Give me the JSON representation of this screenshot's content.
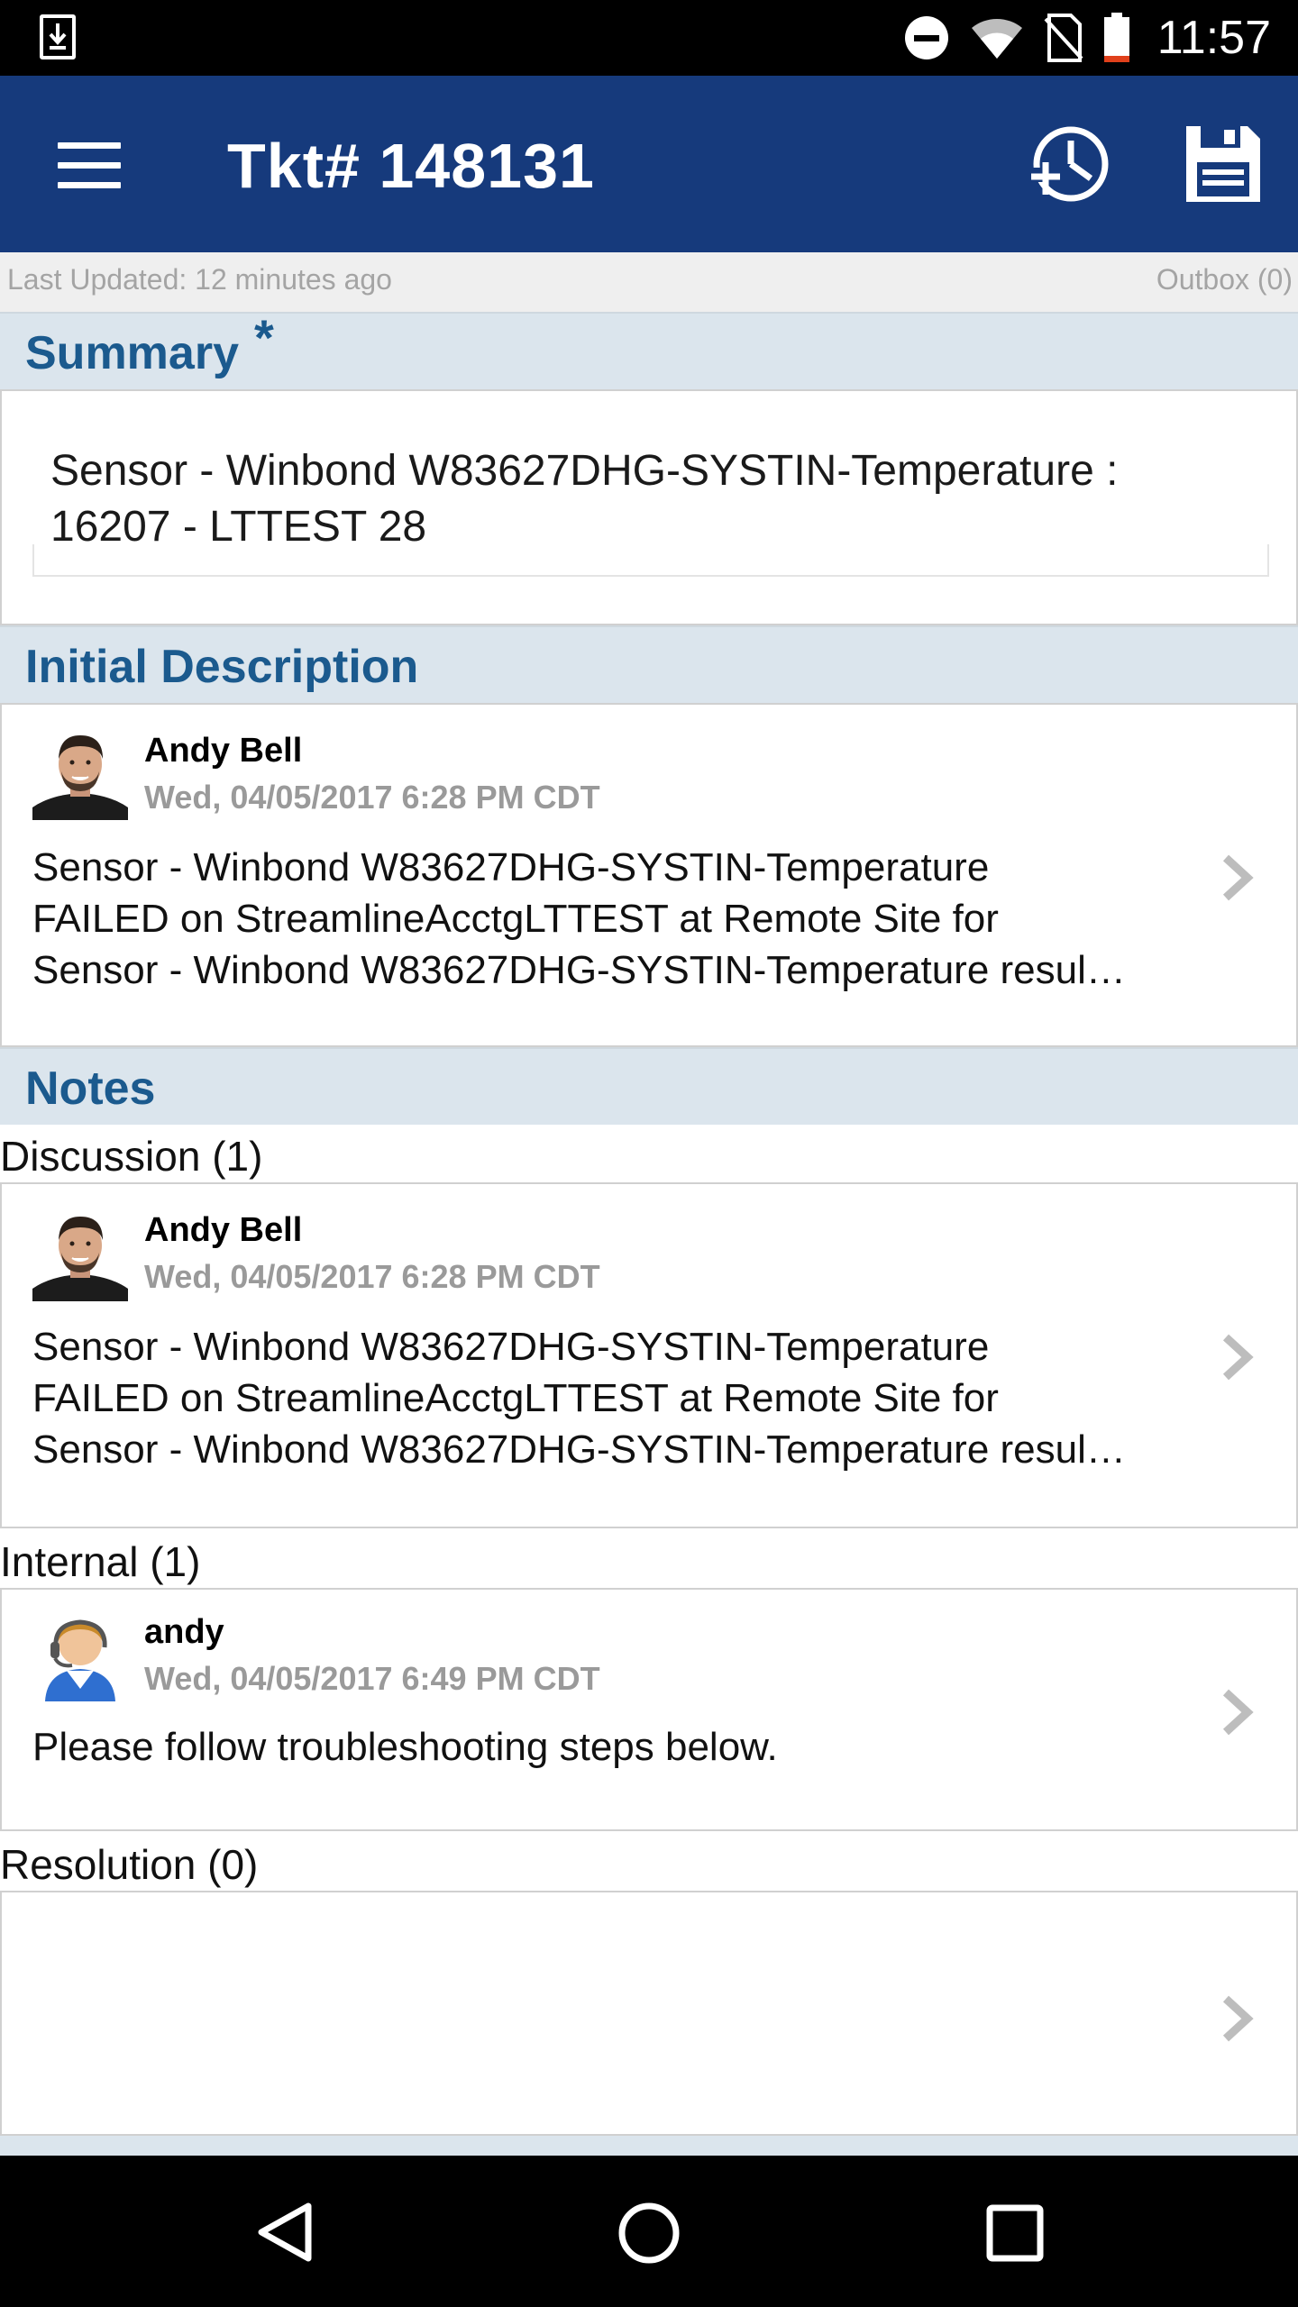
{
  "status_bar": {
    "time": "11:57",
    "icons": [
      "download-icon",
      "dnd-icon",
      "wifi-icon",
      "no-sim-icon",
      "battery-icon"
    ]
  },
  "app_bar": {
    "title": "Tkt# 148131",
    "icons": [
      "menu-icon",
      "time-entry-icon",
      "save-icon"
    ],
    "color": "#163a7c"
  },
  "info": {
    "last_updated": "Last Updated: 12 minutes ago",
    "outbox": "Outbox (0)"
  },
  "summary": {
    "heading": "Summary",
    "required_mark": "*",
    "line1": "Sensor - Winbond W83627DHG-SYSTIN-Temperature :",
    "line2": "16207 - LTTEST 28"
  },
  "initial_description": {
    "heading": "Initial Description",
    "author": "Andy Bell",
    "date": "Wed, 04/05/2017 6:28 PM CDT",
    "lines": [
      "Sensor - Winbond W83627DHG-SYSTIN-Temperature",
      "FAILED on StreamlineAcctgLTTEST at Remote Site for",
      "Sensor - Winbond W83627DHG-SYSTIN-Temperature  resul…"
    ]
  },
  "notes": {
    "heading": "Notes",
    "discussion": {
      "label": "Discussion (1)",
      "author": "Andy Bell",
      "date": "Wed, 04/05/2017 6:28 PM CDT",
      "lines": [
        "Sensor - Winbond W83627DHG-SYSTIN-Temperature",
        "FAILED on StreamlineAcctgLTTEST at Remote Site for",
        "Sensor - Winbond W83627DHG-SYSTIN-Temperature  resul…"
      ]
    },
    "internal": {
      "label": "Internal (1)",
      "author": "andy",
      "date": "Wed, 04/05/2017 6:49 PM CDT",
      "text": "Please follow troubleshooting steps below."
    },
    "resolution": {
      "label": "Resolution (0)"
    }
  },
  "nav_bar": {
    "icons": [
      "back-icon",
      "home-icon",
      "recents-icon"
    ]
  },
  "colors": {
    "section_bg": "#dbe5ed",
    "section_text": "#1b5a8e"
  }
}
